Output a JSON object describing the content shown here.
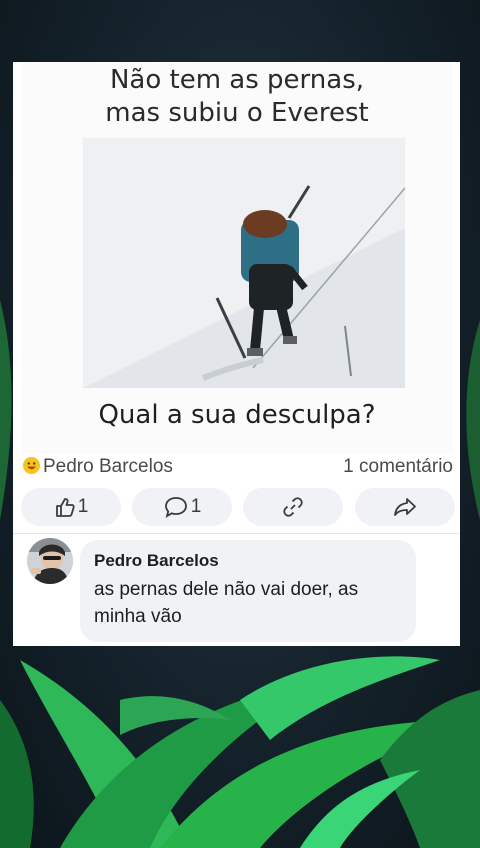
{
  "meme": {
    "top_line1": "Não tem as pernas,",
    "top_line2": "mas subiu o Everest",
    "bottom_text": "Qual a sua desculpa?"
  },
  "post": {
    "author": "Pedro Barcelos",
    "comment_count": "1 comentário",
    "emoji": "grinning-face-icon"
  },
  "actions": {
    "like_count": "1",
    "comment_count": "1"
  },
  "comment": {
    "author": "Pedro Barcelos",
    "text": "as pernas dele não vai doer,  as minha vão"
  },
  "colors": {
    "card": "#ffffff",
    "pill": "#f0f2f5",
    "leaf_green": "#27b34a",
    "background": "#15222b"
  }
}
